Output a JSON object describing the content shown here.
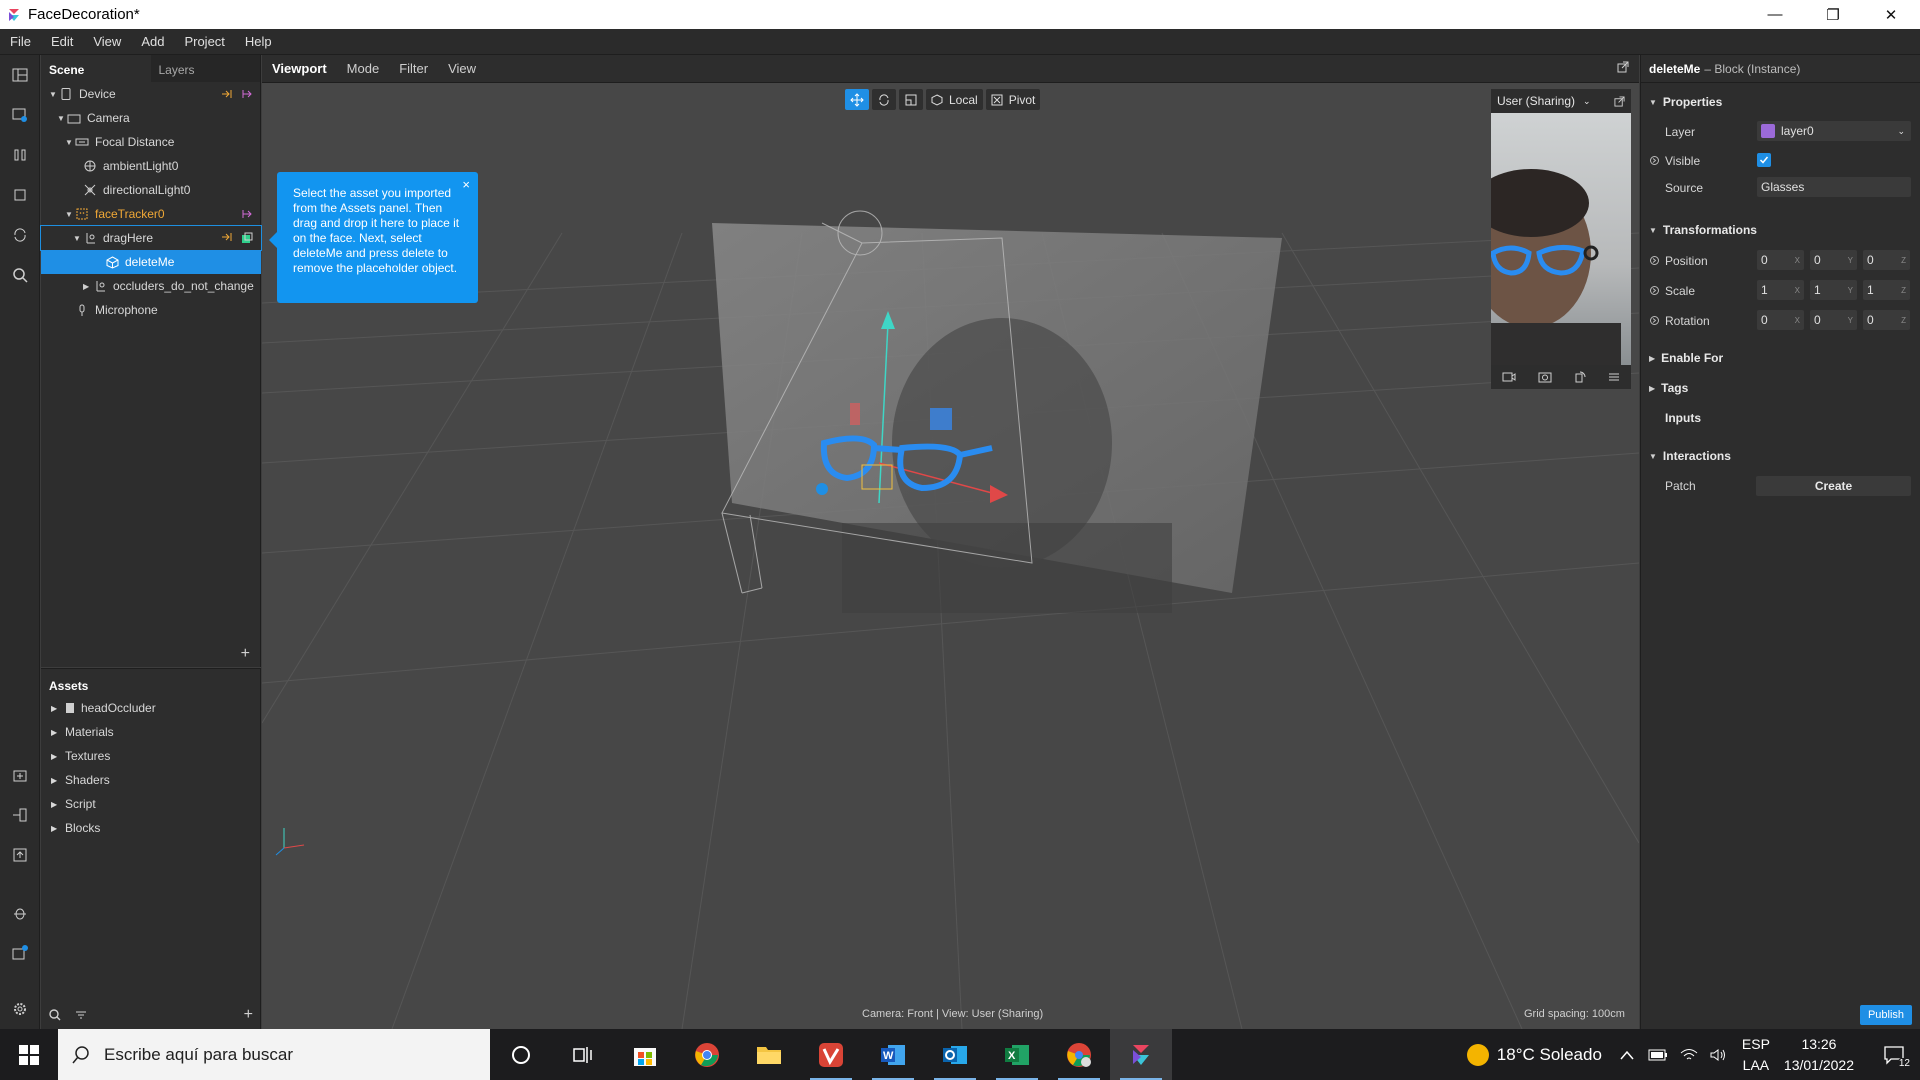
{
  "window": {
    "title": "FaceDecoration*",
    "minimize": "—",
    "maximize": "❐",
    "close": "✕"
  },
  "menu": [
    "File",
    "Edit",
    "View",
    "Add",
    "Project",
    "Help"
  ],
  "scene": {
    "tabs": [
      "Scene",
      "Layers"
    ],
    "items": [
      {
        "label": "Device"
      },
      {
        "label": "Camera"
      },
      {
        "label": "Focal Distance"
      },
      {
        "label": "ambientLight0"
      },
      {
        "label": "directionalLight0"
      },
      {
        "label": "faceTracker0"
      },
      {
        "label": "dragHere"
      },
      {
        "label": "deleteMe"
      },
      {
        "label": "occluders_do_not_change"
      },
      {
        "label": "Microphone"
      }
    ],
    "add": "+"
  },
  "assets": {
    "title": "Assets",
    "items": [
      "headOccluder",
      "Materials",
      "Textures",
      "Shaders",
      "Script",
      "Blocks"
    ],
    "add": "+"
  },
  "viewport": {
    "tabs": [
      "Viewport",
      "Mode",
      "Filter",
      "View"
    ],
    "toolbar": {
      "local": "Local",
      "pivot": "Pivot"
    },
    "tooltip": "Select the asset you imported from the Assets panel. Then drag and drop it here to place it on the face. Next, select deleteMe and press delete to remove the placeholder object.",
    "tooltip_close": "×",
    "preview": {
      "label": "User (Sharing)"
    },
    "status_center": "Camera: Front | View: User (Sharing)",
    "status_right": "Grid spacing: 100cm"
  },
  "inspector": {
    "name": "deleteMe",
    "type": "– Block (Instance)",
    "sections": {
      "properties": "Properties",
      "transformations": "Transformations",
      "enable_for": "Enable For",
      "tags": "Tags",
      "inputs": "Inputs",
      "interactions": "Interactions"
    },
    "layer_label": "Layer",
    "layer_value": "layer0",
    "visible_label": "Visible",
    "visible_checked": true,
    "source_label": "Source",
    "source_value": "Glasses",
    "position_label": "Position",
    "position": [
      "0",
      "0",
      "0"
    ],
    "scale_label": "Scale",
    "scale": [
      "1",
      "1",
      "1"
    ],
    "rotation_label": "Rotation",
    "rotation": [
      "0",
      "0",
      "0"
    ],
    "axes": [
      "X",
      "Y",
      "Z"
    ],
    "patch_label": "Patch",
    "create_label": "Create",
    "publish_label": "Publish"
  },
  "taskbar": {
    "search_placeholder": "Escribe aquí para buscar",
    "weather": "18°C  Soleado",
    "lang_1": "ESP",
    "lang_2": "LAA",
    "time": "13:26",
    "date": "13/01/2022",
    "notifications": "12"
  },
  "colors": {
    "accent": "#1f8fe5",
    "tooltip": "#1295f0",
    "highlight": "#f0a836",
    "layer": "#9b6ad8"
  }
}
